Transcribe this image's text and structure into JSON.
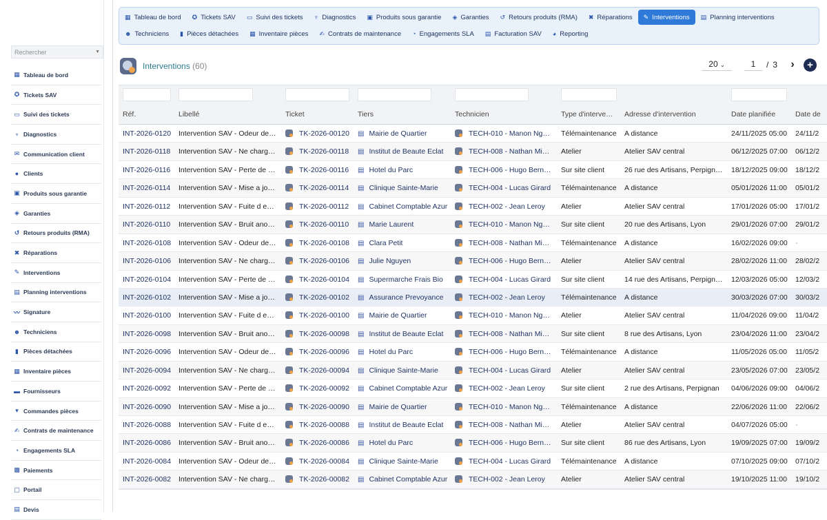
{
  "sidebar": {
    "search_placeholder": "Rechercher",
    "items": [
      {
        "label": "Tableau de bord",
        "icon": "grid-icon",
        "glyph": "▦"
      },
      {
        "label": "Tickets SAV",
        "icon": "ticket-icon",
        "glyph": "✪"
      },
      {
        "label": "Suivi des tickets",
        "icon": "window-icon",
        "glyph": "▭"
      },
      {
        "label": "Diagnostics",
        "icon": "stethoscope-icon",
        "glyph": "♆"
      },
      {
        "label": "Communication client",
        "icon": "comments-icon",
        "glyph": "✉"
      },
      {
        "label": "Clients",
        "icon": "user-icon",
        "glyph": "●"
      },
      {
        "label": "Produits sous garantie",
        "icon": "box-icon",
        "glyph": "▣"
      },
      {
        "label": "Garanties",
        "icon": "shield-icon",
        "glyph": "◈"
      },
      {
        "label": "Retours produits (RMA)",
        "icon": "undo-icon",
        "glyph": "↺"
      },
      {
        "label": "Réparations",
        "icon": "tools-icon",
        "glyph": "✖"
      },
      {
        "label": "Interventions",
        "icon": "wrench-icon",
        "glyph": "✎"
      },
      {
        "label": "Planning interventions",
        "icon": "calendar-icon",
        "glyph": "▤"
      },
      {
        "label": "Signature",
        "icon": "signature-icon",
        "glyph": "〰"
      },
      {
        "label": "Techniciens",
        "icon": "users-icon",
        "glyph": "☻"
      },
      {
        "label": "Pièces détachées",
        "icon": "cube-icon",
        "glyph": "▮"
      },
      {
        "label": "Inventaire pièces",
        "icon": "warehouse-icon",
        "glyph": "▦"
      },
      {
        "label": "Fournisseurs",
        "icon": "truck-icon",
        "glyph": "▬"
      },
      {
        "label": "Commandes pièces",
        "icon": "cart-icon",
        "glyph": "▾"
      },
      {
        "label": "Contrats de maintenance",
        "icon": "contract-icon",
        "glyph": "✍"
      },
      {
        "label": "Engagements SLA",
        "icon": "clock-icon",
        "glyph": "◔"
      },
      {
        "label": "Paiements",
        "icon": "money-icon",
        "glyph": "▩"
      },
      {
        "label": "Portail",
        "icon": "portal-icon",
        "glyph": "▢"
      },
      {
        "label": "Devis",
        "icon": "quote-icon",
        "glyph": "▤"
      }
    ]
  },
  "topnav": {
    "row1": [
      {
        "label": "Tableau de bord",
        "icon": "grid-icon",
        "glyph": "▦",
        "active": false
      },
      {
        "label": "Tickets SAV",
        "icon": "ticket-icon",
        "glyph": "✪",
        "active": false
      },
      {
        "label": "Suivi des tickets",
        "icon": "window-icon",
        "glyph": "▭",
        "active": false
      },
      {
        "label": "Diagnostics",
        "icon": "stethoscope-icon",
        "glyph": "♆",
        "active": false
      },
      {
        "label": "Produits sous garantie",
        "icon": "box-icon",
        "glyph": "▣",
        "active": false
      },
      {
        "label": "Garanties",
        "icon": "shield-icon",
        "glyph": "◈",
        "active": false
      },
      {
        "label": "Retours produits (RMA)",
        "icon": "undo-icon",
        "glyph": "↺",
        "active": false
      },
      {
        "label": "Réparations",
        "icon": "tools-icon",
        "glyph": "✖",
        "active": false
      },
      {
        "label": "Interventions",
        "icon": "wrench-icon",
        "glyph": "✎",
        "active": true
      },
      {
        "label": "Planning interventions",
        "icon": "calendar-icon",
        "glyph": "▤",
        "active": false
      }
    ],
    "row2": [
      {
        "label": "Techniciens",
        "icon": "users-icon",
        "glyph": "☻",
        "active": false
      },
      {
        "label": "Pièces détachées",
        "icon": "cube-icon",
        "glyph": "▮",
        "active": false
      },
      {
        "label": "Inventaire pièces",
        "icon": "warehouse-icon",
        "glyph": "▦",
        "active": false
      },
      {
        "label": "Contrats de maintenance",
        "icon": "contract-icon",
        "glyph": "✍",
        "active": false
      },
      {
        "label": "Engagements SLA",
        "icon": "clock-icon",
        "glyph": "◔",
        "active": false
      },
      {
        "label": "Facturation SAV",
        "icon": "invoice-icon",
        "glyph": "▤",
        "active": false
      },
      {
        "label": "Reporting",
        "icon": "chart-pie-icon",
        "glyph": "◕",
        "active": false
      }
    ]
  },
  "list": {
    "title": "Interventions",
    "count": "(60)",
    "per_page": "20",
    "page": "1",
    "page_sep": "/",
    "total_pages": "3",
    "add_label": "+"
  },
  "columns": [
    "Réf.",
    "Libellé",
    "Ticket",
    "Tiers",
    "Technicien",
    "Type d'interve…",
    "Adresse d'intervention",
    "Date planifiée",
    "Date de"
  ],
  "rows": [
    [
      "INT-2026-0120",
      "Intervention SAV - Odeur de…",
      "TK-2026-00120",
      "Mairie de Quartier",
      "TECH-010 - Manon Ng…",
      "Télémaintenance",
      "A distance",
      "24/11/2025 05:00",
      "24/11/2"
    ],
    [
      "INT-2026-0118",
      "Intervention SAV - Ne charg…",
      "TK-2026-00118",
      "Institut de Beaute Eclat",
      "TECH-008 - Nathan Mi…",
      "Atelier",
      "Atelier SAV central",
      "06/12/2025 07:00",
      "06/12/2"
    ],
    [
      "INT-2026-0116",
      "Intervention SAV - Perte de …",
      "TK-2026-00116",
      "Hotel du Parc",
      "TECH-006 - Hugo Bern…",
      "Sur site client",
      "26 rue des Artisans, Perpign…",
      "18/12/2025 09:00",
      "18/12/2"
    ],
    [
      "INT-2026-0114",
      "Intervention SAV - Mise a jo…",
      "TK-2026-00114",
      "Clinique Sainte-Marie",
      "TECH-004 - Lucas Girard",
      "Télémaintenance",
      "A distance",
      "05/01/2026 11:00",
      "05/01/2"
    ],
    [
      "INT-2026-0112",
      "Intervention SAV - Fuite d e…",
      "TK-2026-00112",
      "Cabinet Comptable Azur",
      "TECH-002 - Jean Leroy",
      "Atelier",
      "Atelier SAV central",
      "17/01/2026 05:00",
      "17/01/2"
    ],
    [
      "INT-2026-0110",
      "Intervention SAV - Bruit ano…",
      "TK-2026-00110",
      "Marie Laurent",
      "TECH-010 - Manon Ng…",
      "Sur site client",
      "20 rue des Artisans, Lyon",
      "29/01/2026 07:00",
      "29/01/2"
    ],
    [
      "INT-2026-0108",
      "Intervention SAV - Odeur de…",
      "TK-2026-00108",
      "Clara Petit",
      "TECH-008 - Nathan Mi…",
      "Télémaintenance",
      "A distance",
      "16/02/2026 09:00",
      "-"
    ],
    [
      "INT-2026-0106",
      "Intervention SAV - Ne charg…",
      "TK-2026-00106",
      "Julie Nguyen",
      "TECH-006 - Hugo Bern…",
      "Atelier",
      "Atelier SAV central",
      "28/02/2026 11:00",
      "28/02/2"
    ],
    [
      "INT-2026-0104",
      "Intervention SAV - Perte de …",
      "TK-2026-00104",
      "Supermarche Frais Bio",
      "TECH-004 - Lucas Girard",
      "Sur site client",
      "14 rue des Artisans, Perpign…",
      "12/03/2026 05:00",
      "12/03/2"
    ],
    [
      "INT-2026-0102",
      "Intervention SAV - Mise a jo…",
      "TK-2026-00102",
      "Assurance Prevoyance",
      "TECH-002 - Jean Leroy",
      "Télémaintenance",
      "A distance",
      "30/03/2026 07:00",
      "30/03/2"
    ],
    [
      "INT-2026-0100",
      "Intervention SAV - Fuite d e…",
      "TK-2026-00100",
      "Mairie de Quartier",
      "TECH-010 - Manon Ng…",
      "Atelier",
      "Atelier SAV central",
      "11/04/2026 09:00",
      "11/04/2"
    ],
    [
      "INT-2026-0098",
      "Intervention SAV - Bruit ano…",
      "TK-2026-00098",
      "Institut de Beaute Eclat",
      "TECH-008 - Nathan Mi…",
      "Sur site client",
      "8 rue des Artisans, Lyon",
      "23/04/2026 11:00",
      "23/04/2"
    ],
    [
      "INT-2026-0096",
      "Intervention SAV - Odeur de…",
      "TK-2026-00096",
      "Hotel du Parc",
      "TECH-006 - Hugo Bern…",
      "Télémaintenance",
      "A distance",
      "11/05/2026 05:00",
      "11/05/2"
    ],
    [
      "INT-2026-0094",
      "Intervention SAV - Ne charg…",
      "TK-2026-00094",
      "Clinique Sainte-Marie",
      "TECH-004 - Lucas Girard",
      "Atelier",
      "Atelier SAV central",
      "23/05/2026 07:00",
      "23/05/2"
    ],
    [
      "INT-2026-0092",
      "Intervention SAV - Perte de …",
      "TK-2026-00092",
      "Cabinet Comptable Azur",
      "TECH-002 - Jean Leroy",
      "Sur site client",
      "2 rue des Artisans, Perpignan",
      "04/06/2026 09:00",
      "04/06/2"
    ],
    [
      "INT-2026-0090",
      "Intervention SAV - Mise a jo…",
      "TK-2026-00090",
      "Mairie de Quartier",
      "TECH-010 - Manon Ng…",
      "Télémaintenance",
      "A distance",
      "22/06/2026 11:00",
      "22/06/2"
    ],
    [
      "INT-2026-0088",
      "Intervention SAV - Fuite d e…",
      "TK-2026-00088",
      "Institut de Beaute Eclat",
      "TECH-008 - Nathan Mi…",
      "Atelier",
      "Atelier SAV central",
      "04/07/2026 05:00",
      "-"
    ],
    [
      "INT-2026-0086",
      "Intervention SAV - Bruit ano…",
      "TK-2026-00086",
      "Hotel du Parc",
      "TECH-006 - Hugo Bern…",
      "Sur site client",
      "86 rue des Artisans, Lyon",
      "19/09/2025 07:00",
      "19/09/2"
    ],
    [
      "INT-2026-0084",
      "Intervention SAV - Odeur de…",
      "TK-2026-00084",
      "Clinique Sainte-Marie",
      "TECH-004 - Lucas Girard",
      "Télémaintenance",
      "A distance",
      "07/10/2025 09:00",
      "07/10/2"
    ],
    [
      "INT-2026-0082",
      "Intervention SAV - Ne charg…",
      "TK-2026-00082",
      "Cabinet Comptable Azur",
      "TECH-002 - Jean Leroy",
      "Atelier",
      "Atelier SAV central",
      "19/10/2025 11:00",
      "19/10/2"
    ]
  ]
}
